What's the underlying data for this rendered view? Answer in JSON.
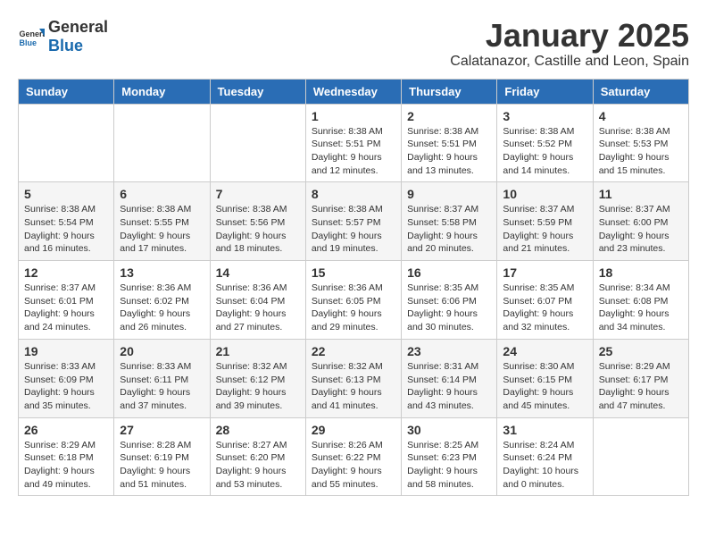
{
  "logo": {
    "general": "General",
    "blue": "Blue"
  },
  "title": "January 2025",
  "subtitle": "Calatanazor, Castille and Leon, Spain",
  "days": [
    "Sunday",
    "Monday",
    "Tuesday",
    "Wednesday",
    "Thursday",
    "Friday",
    "Saturday"
  ],
  "weeks": [
    [
      {
        "day": "",
        "sunrise": "",
        "sunset": "",
        "daylight": ""
      },
      {
        "day": "",
        "sunrise": "",
        "sunset": "",
        "daylight": ""
      },
      {
        "day": "",
        "sunrise": "",
        "sunset": "",
        "daylight": ""
      },
      {
        "day": "1",
        "sunrise": "Sunrise: 8:38 AM",
        "sunset": "Sunset: 5:51 PM",
        "daylight": "Daylight: 9 hours and 12 minutes."
      },
      {
        "day": "2",
        "sunrise": "Sunrise: 8:38 AM",
        "sunset": "Sunset: 5:51 PM",
        "daylight": "Daylight: 9 hours and 13 minutes."
      },
      {
        "day": "3",
        "sunrise": "Sunrise: 8:38 AM",
        "sunset": "Sunset: 5:52 PM",
        "daylight": "Daylight: 9 hours and 14 minutes."
      },
      {
        "day": "4",
        "sunrise": "Sunrise: 8:38 AM",
        "sunset": "Sunset: 5:53 PM",
        "daylight": "Daylight: 9 hours and 15 minutes."
      }
    ],
    [
      {
        "day": "5",
        "sunrise": "Sunrise: 8:38 AM",
        "sunset": "Sunset: 5:54 PM",
        "daylight": "Daylight: 9 hours and 16 minutes."
      },
      {
        "day": "6",
        "sunrise": "Sunrise: 8:38 AM",
        "sunset": "Sunset: 5:55 PM",
        "daylight": "Daylight: 9 hours and 17 minutes."
      },
      {
        "day": "7",
        "sunrise": "Sunrise: 8:38 AM",
        "sunset": "Sunset: 5:56 PM",
        "daylight": "Daylight: 9 hours and 18 minutes."
      },
      {
        "day": "8",
        "sunrise": "Sunrise: 8:38 AM",
        "sunset": "Sunset: 5:57 PM",
        "daylight": "Daylight: 9 hours and 19 minutes."
      },
      {
        "day": "9",
        "sunrise": "Sunrise: 8:37 AM",
        "sunset": "Sunset: 5:58 PM",
        "daylight": "Daylight: 9 hours and 20 minutes."
      },
      {
        "day": "10",
        "sunrise": "Sunrise: 8:37 AM",
        "sunset": "Sunset: 5:59 PM",
        "daylight": "Daylight: 9 hours and 21 minutes."
      },
      {
        "day": "11",
        "sunrise": "Sunrise: 8:37 AM",
        "sunset": "Sunset: 6:00 PM",
        "daylight": "Daylight: 9 hours and 23 minutes."
      }
    ],
    [
      {
        "day": "12",
        "sunrise": "Sunrise: 8:37 AM",
        "sunset": "Sunset: 6:01 PM",
        "daylight": "Daylight: 9 hours and 24 minutes."
      },
      {
        "day": "13",
        "sunrise": "Sunrise: 8:36 AM",
        "sunset": "Sunset: 6:02 PM",
        "daylight": "Daylight: 9 hours and 26 minutes."
      },
      {
        "day": "14",
        "sunrise": "Sunrise: 8:36 AM",
        "sunset": "Sunset: 6:04 PM",
        "daylight": "Daylight: 9 hours and 27 minutes."
      },
      {
        "day": "15",
        "sunrise": "Sunrise: 8:36 AM",
        "sunset": "Sunset: 6:05 PM",
        "daylight": "Daylight: 9 hours and 29 minutes."
      },
      {
        "day": "16",
        "sunrise": "Sunrise: 8:35 AM",
        "sunset": "Sunset: 6:06 PM",
        "daylight": "Daylight: 9 hours and 30 minutes."
      },
      {
        "day": "17",
        "sunrise": "Sunrise: 8:35 AM",
        "sunset": "Sunset: 6:07 PM",
        "daylight": "Daylight: 9 hours and 32 minutes."
      },
      {
        "day": "18",
        "sunrise": "Sunrise: 8:34 AM",
        "sunset": "Sunset: 6:08 PM",
        "daylight": "Daylight: 9 hours and 34 minutes."
      }
    ],
    [
      {
        "day": "19",
        "sunrise": "Sunrise: 8:33 AM",
        "sunset": "Sunset: 6:09 PM",
        "daylight": "Daylight: 9 hours and 35 minutes."
      },
      {
        "day": "20",
        "sunrise": "Sunrise: 8:33 AM",
        "sunset": "Sunset: 6:11 PM",
        "daylight": "Daylight: 9 hours and 37 minutes."
      },
      {
        "day": "21",
        "sunrise": "Sunrise: 8:32 AM",
        "sunset": "Sunset: 6:12 PM",
        "daylight": "Daylight: 9 hours and 39 minutes."
      },
      {
        "day": "22",
        "sunrise": "Sunrise: 8:32 AM",
        "sunset": "Sunset: 6:13 PM",
        "daylight": "Daylight: 9 hours and 41 minutes."
      },
      {
        "day": "23",
        "sunrise": "Sunrise: 8:31 AM",
        "sunset": "Sunset: 6:14 PM",
        "daylight": "Daylight: 9 hours and 43 minutes."
      },
      {
        "day": "24",
        "sunrise": "Sunrise: 8:30 AM",
        "sunset": "Sunset: 6:15 PM",
        "daylight": "Daylight: 9 hours and 45 minutes."
      },
      {
        "day": "25",
        "sunrise": "Sunrise: 8:29 AM",
        "sunset": "Sunset: 6:17 PM",
        "daylight": "Daylight: 9 hours and 47 minutes."
      }
    ],
    [
      {
        "day": "26",
        "sunrise": "Sunrise: 8:29 AM",
        "sunset": "Sunset: 6:18 PM",
        "daylight": "Daylight: 9 hours and 49 minutes."
      },
      {
        "day": "27",
        "sunrise": "Sunrise: 8:28 AM",
        "sunset": "Sunset: 6:19 PM",
        "daylight": "Daylight: 9 hours and 51 minutes."
      },
      {
        "day": "28",
        "sunrise": "Sunrise: 8:27 AM",
        "sunset": "Sunset: 6:20 PM",
        "daylight": "Daylight: 9 hours and 53 minutes."
      },
      {
        "day": "29",
        "sunrise": "Sunrise: 8:26 AM",
        "sunset": "Sunset: 6:22 PM",
        "daylight": "Daylight: 9 hours and 55 minutes."
      },
      {
        "day": "30",
        "sunrise": "Sunrise: 8:25 AM",
        "sunset": "Sunset: 6:23 PM",
        "daylight": "Daylight: 9 hours and 58 minutes."
      },
      {
        "day": "31",
        "sunrise": "Sunrise: 8:24 AM",
        "sunset": "Sunset: 6:24 PM",
        "daylight": "Daylight: 10 hours and 0 minutes."
      },
      {
        "day": "",
        "sunrise": "",
        "sunset": "",
        "daylight": ""
      }
    ]
  ]
}
